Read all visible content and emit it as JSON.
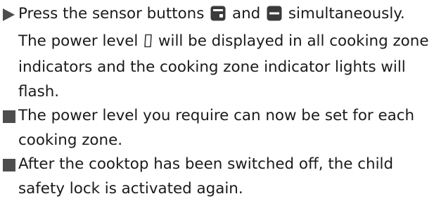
{
  "instructions": {
    "step": {
      "marker_icon": "triangle-right-icon",
      "part1": "Press the sensor buttons",
      "part2": "and",
      "part3": "simultaneously. The power level",
      "part4": "will be displayed in all cooking zone indicators and the cooking zone indicator lights will flash.",
      "button_icon_1": "sensor-button-lock-icon",
      "button_icon_2": "sensor-button-minus-icon",
      "power_level_glyph": "seven-segment-zero-icon"
    },
    "results": [
      {
        "marker_icon": "square-bullet-icon",
        "text": "The power level you require can now be set for each cooking zone."
      },
      {
        "marker_icon": "square-bullet-icon",
        "text": "After the cooktop has been switched off, the child safety lock is activated again."
      }
    ],
    "colors": {
      "text": "#1a1a1a",
      "marker": "#4d4d4d",
      "icon_fill": "#3a3a3a"
    }
  }
}
